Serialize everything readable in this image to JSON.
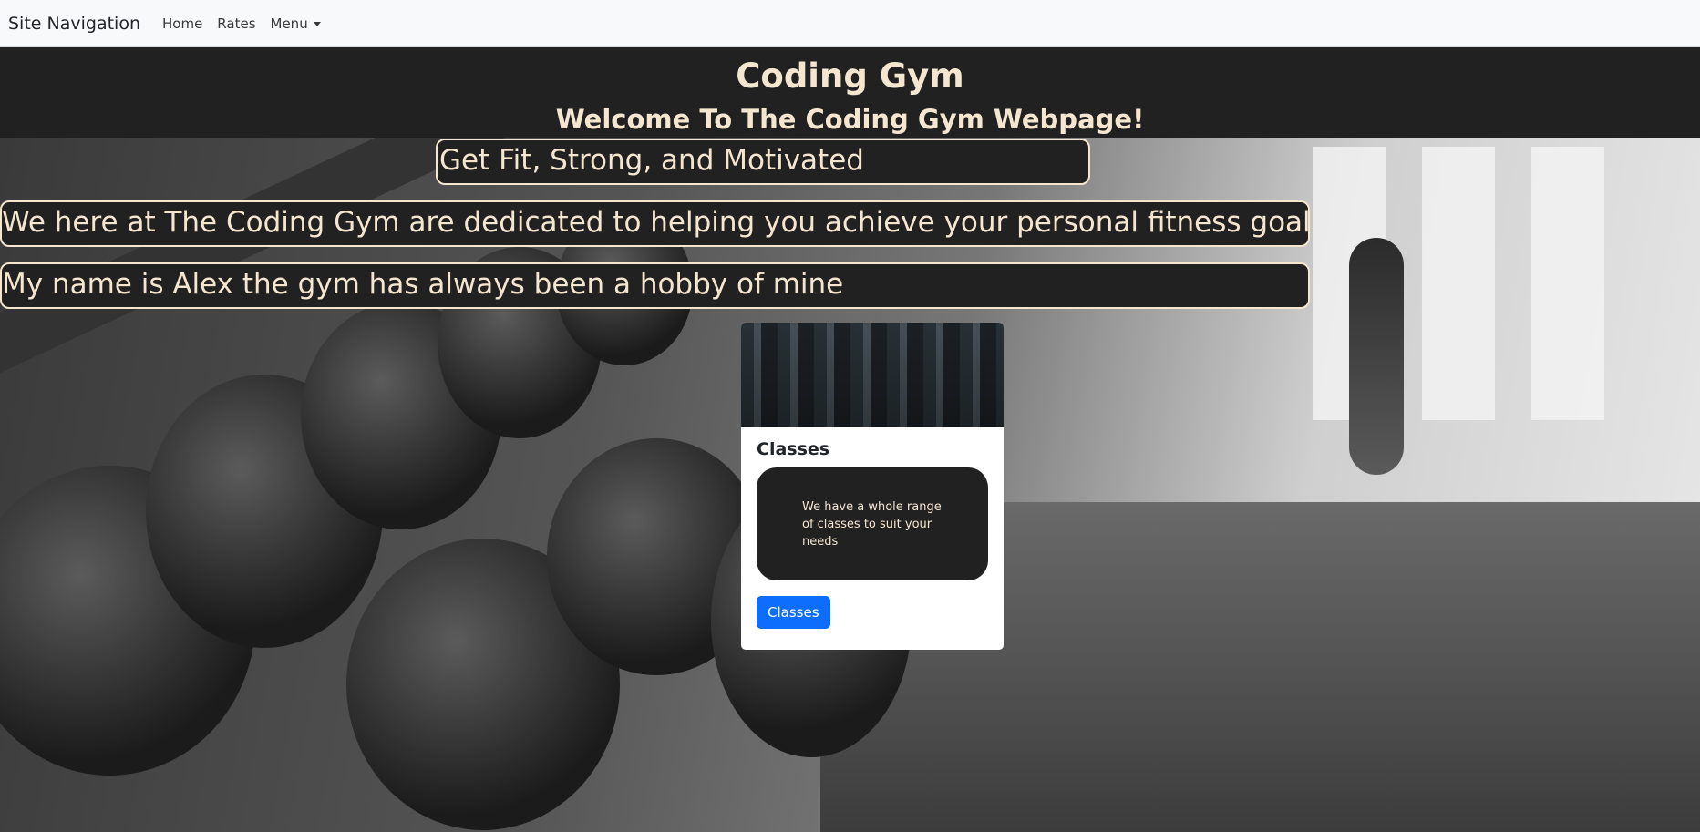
{
  "navbar": {
    "brand": "Site Navigation",
    "links": [
      "Home",
      "Rates"
    ],
    "menu_label": "Menu"
  },
  "header": {
    "title": "Coding Gym",
    "subtitle": "Welcome To The Coding Gym Webpage!"
  },
  "hero": {
    "tagline": "Get Fit, Strong, and Motivated",
    "mission": "We here at The Coding Gym are dedicated to helping you achieve your personal fitness goals",
    "intro": "My name is Alex the gym has always been a hobby of mine"
  },
  "card": {
    "title": "Classes",
    "text": "We have a whole range of classes to suit your needs",
    "button_label": "Classes"
  },
  "colors": {
    "dark_panel": "#212121",
    "cream_text": "#f5e6d0",
    "primary_button": "#0d6efd",
    "navbar_bg": "#f8f9fa"
  }
}
